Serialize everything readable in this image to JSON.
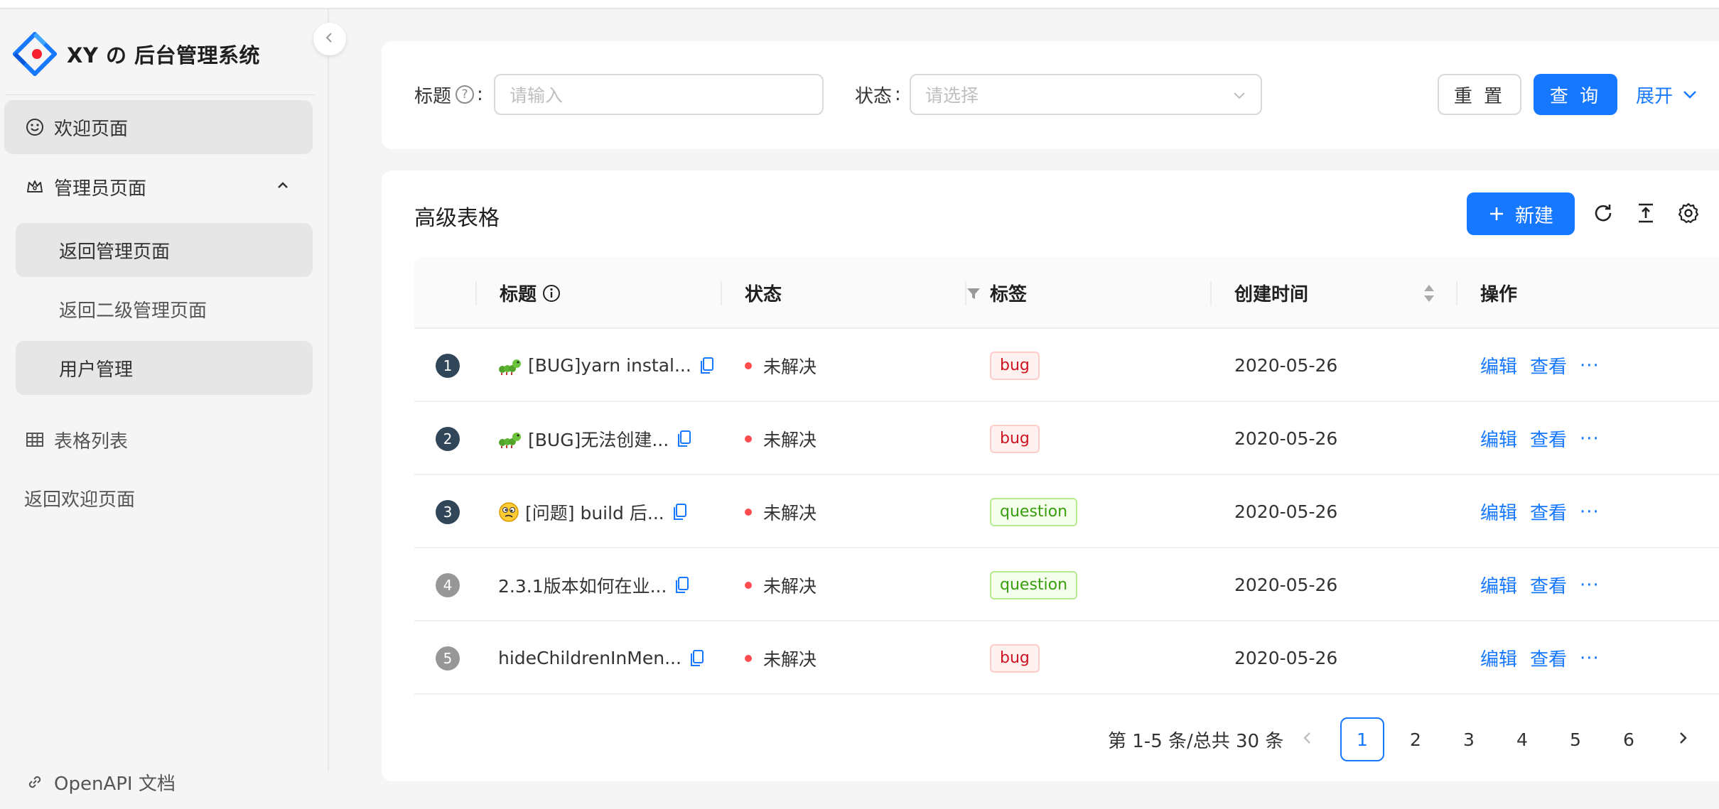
{
  "app": {
    "title": "XY の 后台管理系统"
  },
  "sidebar": {
    "items": [
      {
        "label": "欢迎页面"
      },
      {
        "label": "管理员页面"
      },
      {
        "label": "返回管理页面"
      },
      {
        "label": "返回二级管理页面"
      },
      {
        "label": "用户管理"
      },
      {
        "label": "表格列表"
      },
      {
        "label": "返回欢迎页面"
      },
      {
        "label": "OpenAPI 文档"
      }
    ]
  },
  "search": {
    "title_label": "标题",
    "title_placeholder": "请输入",
    "status_label": "状态",
    "status_placeholder": "请选择",
    "colon": ":",
    "reset_label": "重 置",
    "query_label": "查 询",
    "expand_label": "展开"
  },
  "table": {
    "title": "高级表格",
    "new_label": "新建",
    "columns": [
      "标题",
      "状态",
      "标签",
      "创建时间",
      "操作"
    ],
    "rows": [
      {
        "index": "1",
        "emoji": "bug",
        "title": "[BUG]yarn instal...",
        "status": "未解决",
        "tag": "bug",
        "created": "2020-05-26",
        "edit": "编辑",
        "view": "查看",
        "more": "···"
      },
      {
        "index": "2",
        "emoji": "bug",
        "title": "[BUG]无法创建...",
        "status": "未解决",
        "tag": "bug",
        "created": "2020-05-26",
        "edit": "编辑",
        "view": "查看",
        "more": "···"
      },
      {
        "index": "3",
        "emoji": "face",
        "title": "[问题] build 后...",
        "status": "未解决",
        "tag": "question",
        "created": "2020-05-26",
        "edit": "编辑",
        "view": "查看",
        "more": "···"
      },
      {
        "index": "4",
        "emoji": "",
        "title": "2.3.1版本如何在业...",
        "status": "未解决",
        "tag": "question",
        "created": "2020-05-26",
        "edit": "编辑",
        "view": "查看",
        "more": "···"
      },
      {
        "index": "5",
        "emoji": "",
        "title": "hideChildrenInMen...",
        "status": "未解决",
        "tag": "bug",
        "created": "2020-05-26",
        "edit": "编辑",
        "view": "查看",
        "more": "···"
      }
    ]
  },
  "pagination": {
    "total_text": "第 1-5 条/总共 30 条",
    "pages": [
      "1",
      "2",
      "3",
      "4",
      "5",
      "6"
    ],
    "current": "1"
  },
  "colors": {
    "primary": "#1677ff",
    "danger": "#ff4d4f",
    "success": "#389e0d"
  },
  "icons": [
    "logo-icon",
    "chevron-left-icon",
    "smile-icon",
    "crown-icon",
    "chevron-up-icon",
    "table-icon",
    "link-icon",
    "help-icon",
    "chevron-down-icon",
    "plus-icon",
    "reload-icon",
    "column-height-icon",
    "setting-icon",
    "info-icon",
    "filter-icon",
    "sort-icon",
    "copy-icon",
    "chevron-right-icon"
  ]
}
